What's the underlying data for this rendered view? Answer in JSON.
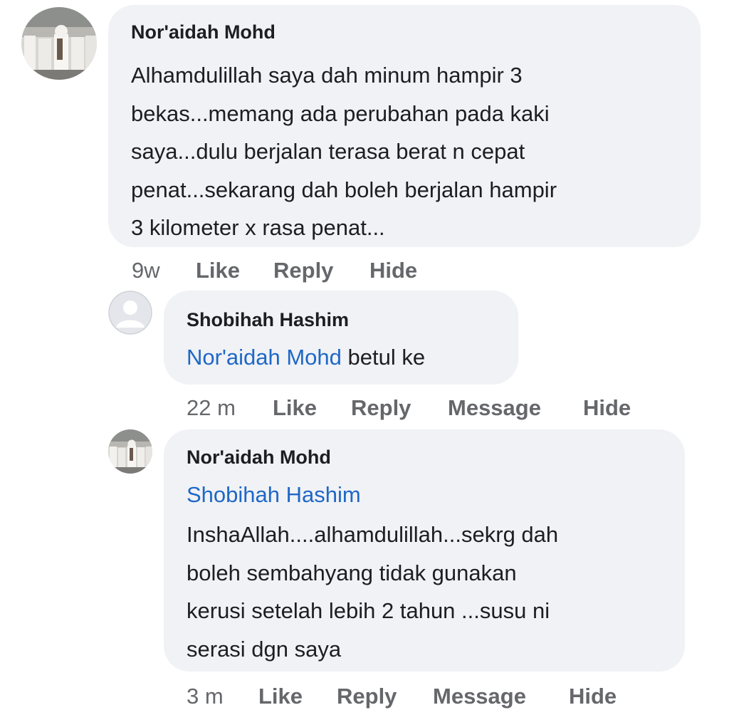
{
  "comment1": {
    "author": "Nor'aidah Mohd",
    "lines": [
      "Alhamdulillah saya dah minum hampir 3",
      "bekas...memang ada perubahan pada kaki",
      "saya...dulu berjalan terasa berat n cepat",
      "penat...sekarang dah boleh berjalan hampir",
      "3 kilometer x rasa penat..."
    ],
    "time": "9w",
    "actions": {
      "like": "Like",
      "reply": "Reply",
      "hide": "Hide"
    }
  },
  "reply1": {
    "author": "Shobihah Hashim",
    "mention": "Nor'aidah Mohd",
    "text": "betul ke",
    "time": "22 m",
    "actions": {
      "like": "Like",
      "reply": "Reply",
      "message": "Message",
      "hide": "Hide"
    }
  },
  "reply2": {
    "author": "Nor'aidah Mohd",
    "mention": "Shobihah Hashim",
    "lines": [
      "InshaAllah....alhamdulillah...sekrg dah",
      "boleh sembahyang tidak gunakan",
      "kerusi setelah lebih 2 tahun ...susu ni",
      "serasi dgn saya"
    ],
    "time": "3 m",
    "actions": {
      "like": "Like",
      "reply": "Reply",
      "message": "Message",
      "hide": "Hide"
    }
  },
  "icons": {
    "avatar_photo": "profile-photo-icon",
    "avatar_default": "default-avatar-icon"
  },
  "colors": {
    "bubble": "#f0f2f5",
    "mention": "#1f67c7",
    "meta": "#65676b",
    "text": "#1c1e21"
  }
}
